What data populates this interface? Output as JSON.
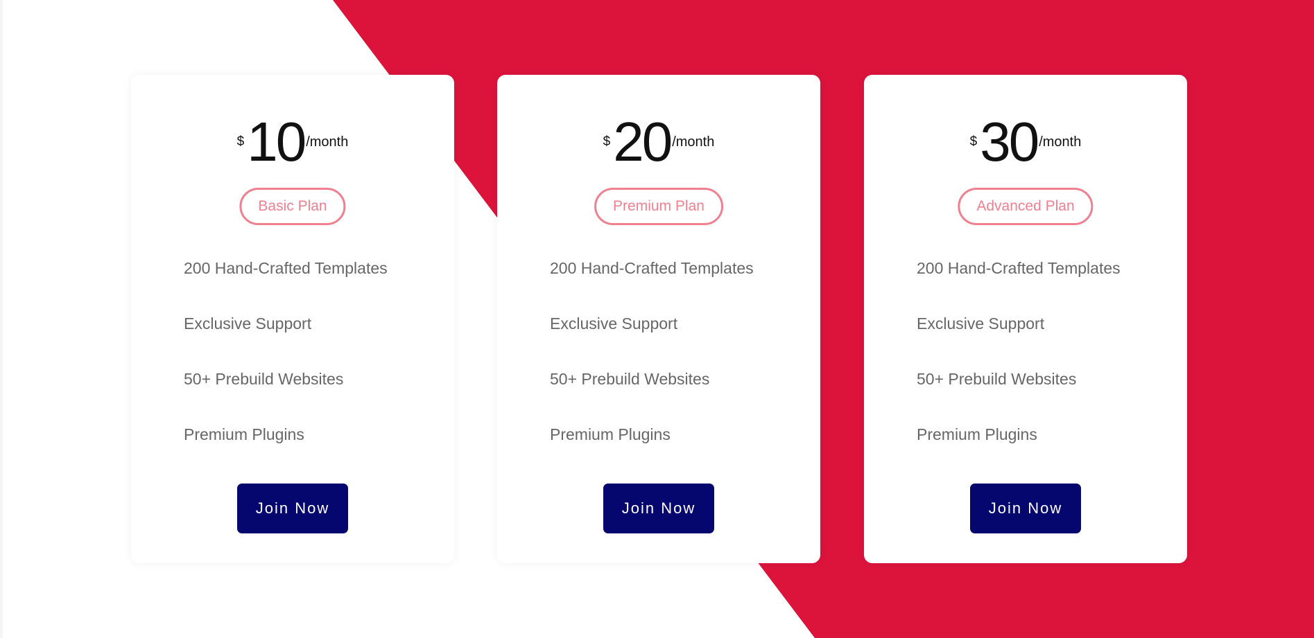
{
  "colors": {
    "accent_red": "#dc143c",
    "pill_pink": "#f07f8f",
    "button_navy": "#05066e",
    "feature_text": "#666666"
  },
  "plans": [
    {
      "currency": "$",
      "amount": "10",
      "period": "/month",
      "name": "Basic Plan",
      "features": [
        "200 Hand-Crafted Templates",
        "Exclusive Support",
        "50+ Prebuild Websites",
        "Premium Plugins"
      ],
      "button_label": "Join Now"
    },
    {
      "currency": "$",
      "amount": "20",
      "period": "/month",
      "name": "Premium Plan",
      "features": [
        "200 Hand-Crafted Templates",
        "Exclusive Support",
        "50+ Prebuild Websites",
        "Premium Plugins"
      ],
      "button_label": "Join Now"
    },
    {
      "currency": "$",
      "amount": "30",
      "period": "/month",
      "name": "Advanced Plan",
      "features": [
        "200 Hand-Crafted Templates",
        "Exclusive Support",
        "50+ Prebuild Websites",
        "Premium Plugins"
      ],
      "button_label": "Join Now"
    }
  ]
}
